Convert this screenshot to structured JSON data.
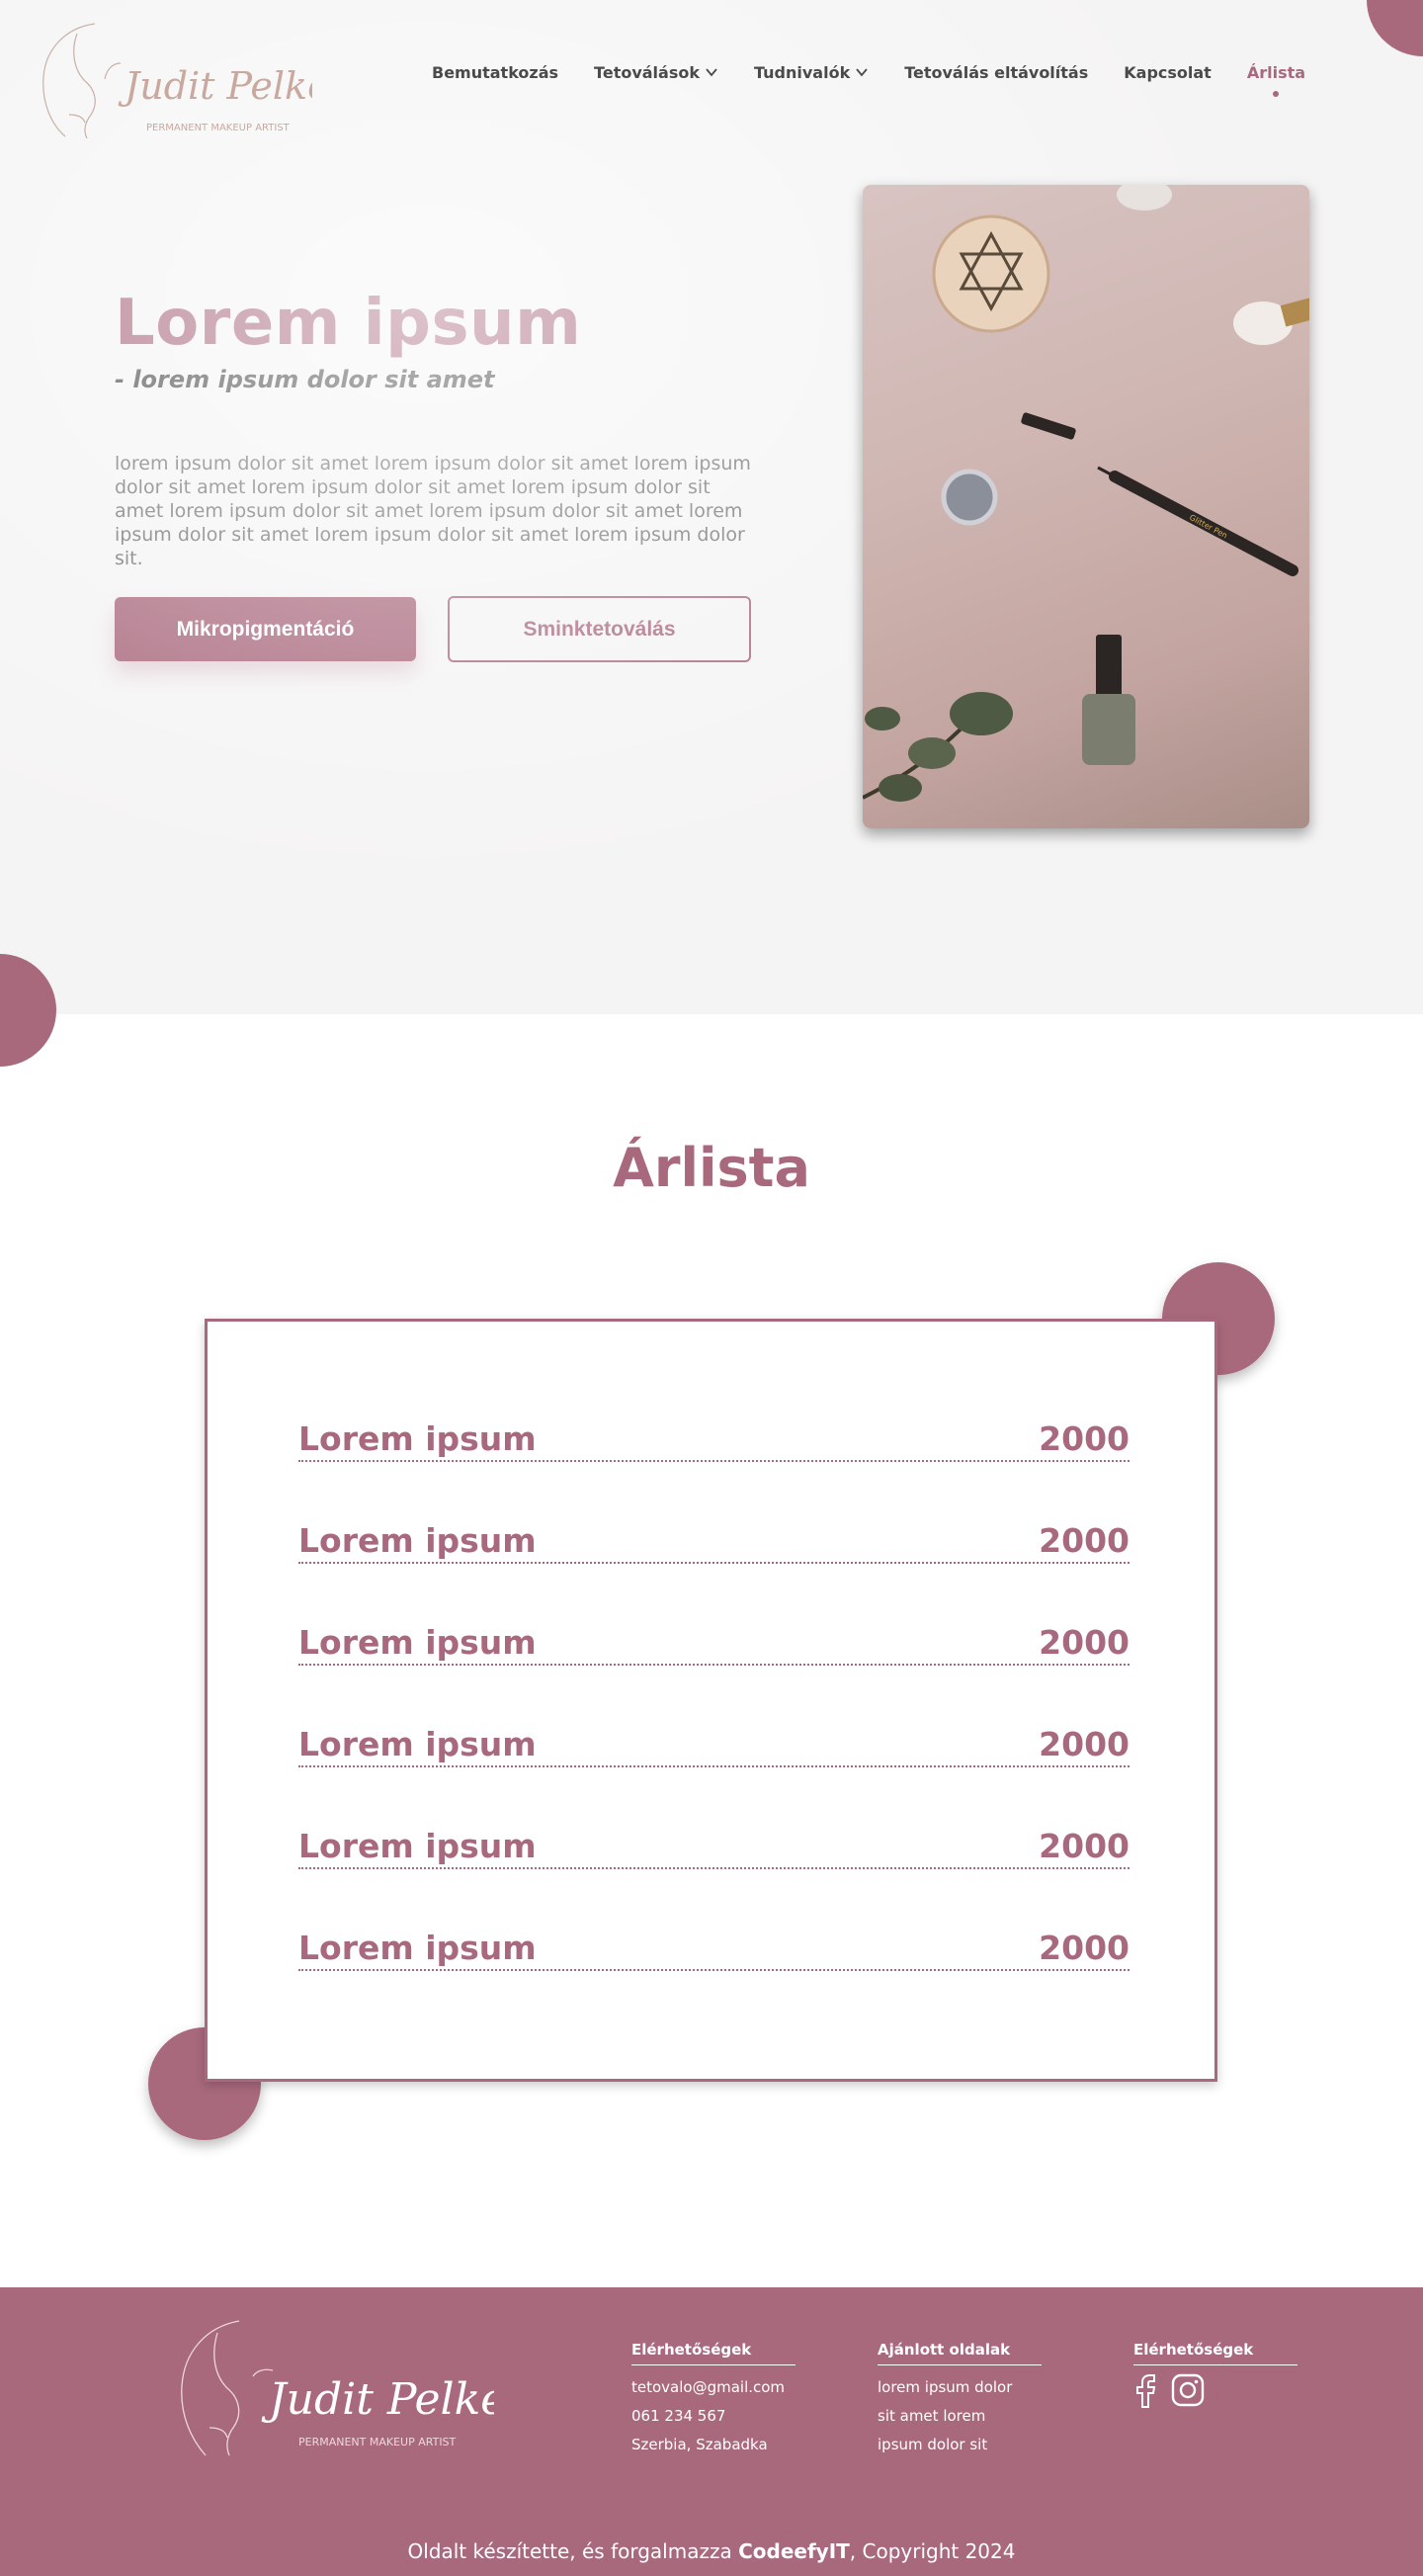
{
  "brand": {
    "signature": "Judit Pelker",
    "tagline": "PERMANENT MAKEUP ARTIST"
  },
  "nav": {
    "items": [
      {
        "label": "Bemutatkozás",
        "dropdown": false,
        "active": false
      },
      {
        "label": "Tetoválások",
        "dropdown": true,
        "active": false
      },
      {
        "label": "Tudnivalók",
        "dropdown": true,
        "active": false
      },
      {
        "label": "Tetoválás eltávolítás",
        "dropdown": false,
        "active": false
      },
      {
        "label": "Kapcsolat",
        "dropdown": false,
        "active": false
      },
      {
        "label": "Árlista",
        "dropdown": false,
        "active": true
      }
    ]
  },
  "hero": {
    "title": "Lorem ipsum",
    "subtitle": "- lorem ipsum dolor sit amet",
    "text": "lorem ipsum dolor sit amet lorem ipsum dolor sit amet lorem ipsum dolor sit amet lorem ipsum dolor sit amet lorem ipsum dolor sit amet lorem ipsum dolor sit amet lorem ipsum dolor sit amet lorem ipsum dolor sit amet lorem ipsum dolor sit amet lorem ipsum dolor sit.",
    "primary_button": "Mikropigmentáció",
    "secondary_button": "Sminktetoválás",
    "photo_label": "Glitter Pen"
  },
  "pricelist": {
    "title": "Árlista",
    "items": [
      {
        "name": "Lorem ipsum",
        "price": "2000"
      },
      {
        "name": "Lorem ipsum",
        "price": "2000"
      },
      {
        "name": "Lorem ipsum",
        "price": "2000"
      },
      {
        "name": "Lorem ipsum",
        "price": "2000"
      },
      {
        "name": "Lorem ipsum",
        "price": "2000"
      },
      {
        "name": "Lorem ipsum",
        "price": "2000"
      }
    ]
  },
  "footer": {
    "contact_heading": "Elérhetőségek",
    "email": "tetovalo@gmail.com",
    "phone": "061 234 567",
    "address": "Szerbia, Szabadka",
    "recommended_heading": "Ajánlott oldalak",
    "recommended_lines": [
      "lorem ipsum dolor",
      "sit amet lorem",
      "ipsum dolor sit"
    ],
    "social_heading": "Elérhetőségek",
    "social_icons": [
      "facebook-icon",
      "instagram-icon"
    ],
    "credit_prefix": "Oldalt készítette, és forgalmazza ",
    "credit_brand": "CodeefyIT",
    "credit_suffix": ", Copyright 2024"
  },
  "colors": {
    "accent": "#a9697d",
    "text_dark": "#4a4a4a",
    "hero_bg": "#f5f4f4"
  }
}
